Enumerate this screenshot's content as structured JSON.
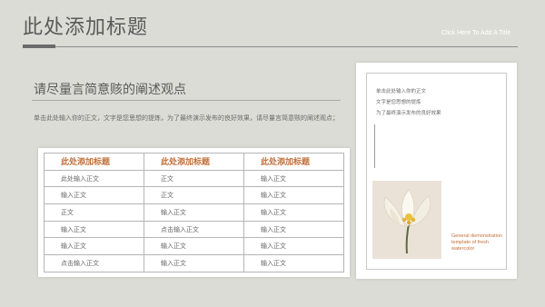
{
  "header": {
    "title": "此处添加标题",
    "subtitle_en": "Click Here To Add A Title"
  },
  "section": {
    "heading": "请尽量言简意赅的阐述观点",
    "description": "单击此处输入你的正文，文字是您思想的提炼，为了最终演示发布的良好效果，请尽量言简意赅的阐述观点；"
  },
  "table": {
    "headers": [
      "此处添加标题",
      "此处添加标题",
      "此处添加标题"
    ],
    "rows": [
      [
        "此处输入正文",
        "正文",
        "输入正文"
      ],
      [
        "输入正文",
        "正文",
        "输入正文"
      ],
      [
        "正文",
        "输入正文",
        "输入正文"
      ],
      [
        "输入正文",
        "点击输入正文",
        "输入正文"
      ],
      [
        "输入正文",
        "输入正文",
        "输入正文"
      ],
      [
        "点击输入正文",
        "输入正文",
        "输入正文"
      ]
    ]
  },
  "side_card": {
    "lines": [
      "单击此处输入你的正文",
      "文字是您思想的提炼",
      "为了最终演示发布的良好效果"
    ],
    "image_name": "flower-image",
    "caption": "General demonstration template of fresh watercolor"
  },
  "colors": {
    "background": "#dcdcd6",
    "accent": "#c1703a",
    "title": "#5a5a5a"
  }
}
